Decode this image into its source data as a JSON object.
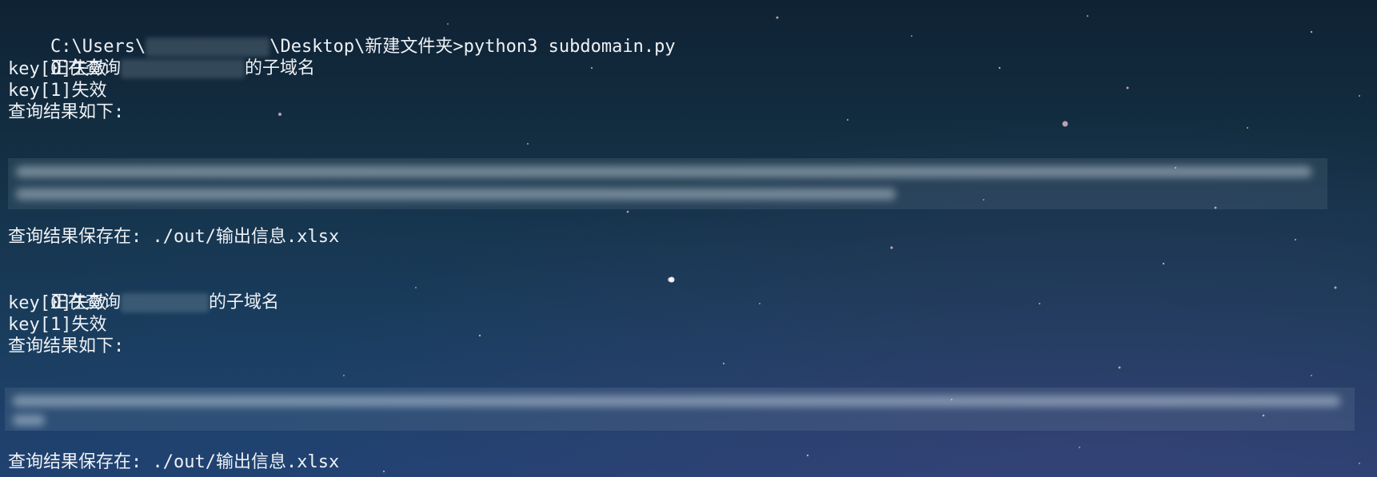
{
  "window": {
    "type": "windows-terminal",
    "theme": "starry night background"
  },
  "terminal": {
    "prompt": {
      "prefix": "C:\\Users\\",
      "redacted_user": "",
      "path_rest": "\\Desktop\\新建文件夹>",
      "command": "python3 subdomain.py"
    },
    "query1": {
      "querying_prefix": "正在查询",
      "querying_suffix": "的子域名",
      "key0": "key[0]失效",
      "key1": "key[1]失效",
      "results_header": "查询结果如下:",
      "saved_to_label": "查询结果保存在: ./out/输出信息.xlsx"
    },
    "query2": {
      "querying_prefix": "正在查询",
      "querying_suffix": "的子域名",
      "key0": "key[0]失效",
      "key1": "key[1]失效",
      "results_header": "查询结果如下:",
      "saved_to_label": "查询结果保存在: ./out/输出信息.xlsx"
    }
  },
  "colors": {
    "text": "#eef1f5",
    "background_top": "#0f2234",
    "background_bottom": "#223f6c"
  }
}
